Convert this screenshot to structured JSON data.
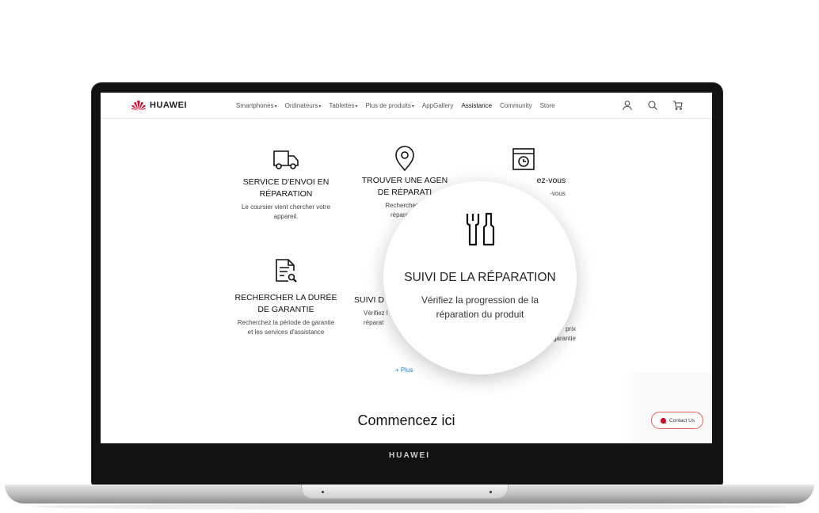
{
  "device": {
    "bezel_brand": "HUAWEI"
  },
  "nav": {
    "logo_text": "HUAWEI",
    "menu": [
      {
        "label": "Smartphones",
        "caret": "▾"
      },
      {
        "label": "Ordinateurs",
        "caret": "▾"
      },
      {
        "label": "Tablettes",
        "caret": "▾"
      },
      {
        "label": "Plus de produits",
        "caret": "▾"
      },
      {
        "label": "AppGallery",
        "caret": ""
      },
      {
        "label": "Assistance",
        "caret": ""
      },
      {
        "label": "Community",
        "caret": ""
      },
      {
        "label": "Store",
        "caret": ""
      }
    ],
    "icons": [
      "user-icon",
      "search-icon",
      "cart-icon"
    ]
  },
  "services": [
    {
      "icon": "truck-icon",
      "title_lines": [
        "SERVICE D'ENVOI EN",
        "RÉPARATION"
      ],
      "desc_lines": [
        "Le coursier vient chercher votre",
        "appareil."
      ]
    },
    {
      "icon": "location-pin-icon",
      "title_lines": [
        "TROUVER UNE AGEN",
        "DE RÉPARATI"
      ],
      "desc_lines": [
        "Recherchez d",
        "réparation"
      ]
    },
    {
      "icon": "calendar-clock-icon",
      "title_lines": [
        "ez-vous"
      ],
      "desc_lines": [
        "-vous"
      ]
    },
    {
      "icon": "document-search-icon",
      "title_lines": [
        "RECHERCHER LA DURÉE",
        "DE GARANTIE"
      ],
      "desc_lines": [
        "Recherchez la période de garantie",
        "et les services d'assistance"
      ]
    },
    {
      "icon": "",
      "title_lines": [
        "SUIVI D"
      ],
      "desc_lines": [
        "Vérifiez l",
        "réparat"
      ]
    },
    {
      "icon": "",
      "title_lines": [
        ""
      ],
      "desc_lines": [
        "prix",
        "garantie"
      ]
    }
  ],
  "more_link": "+ Plus",
  "section_heading": "Commencez ici",
  "contact_button": "Contact Us",
  "magnifier": {
    "icon": "tools-icon",
    "title": "SUIVI DE LA RÉPARATION",
    "desc_lines": [
      "Vérifiez la progression de la",
      "réparation du produit"
    ]
  },
  "colors": {
    "brand_red": "#CF0A2C",
    "link_blue": "#1E7ED4",
    "contact_border": "#E25A5A"
  }
}
